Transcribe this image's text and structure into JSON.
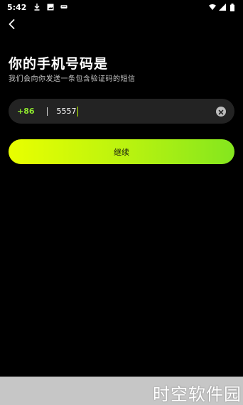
{
  "status_bar": {
    "time": "5:42",
    "icons_left": [
      "download-icon",
      "image-icon",
      "message-icon"
    ],
    "icons_right": [
      "wifi-icon",
      "signal-icon",
      "battery-icon"
    ]
  },
  "nav": {
    "back_icon": "chevron-left-icon"
  },
  "header": {
    "title": "你的手机号码是",
    "subtitle": "我们会向你发送一条包含验证码的短信"
  },
  "phone_input": {
    "country_code": "+86",
    "value": "5557",
    "clear_icon": "clear-icon"
  },
  "continue_button": {
    "label": "继续"
  },
  "watermark": {
    "text": "时空软件园"
  },
  "colors": {
    "accent_green": "#8ee62e",
    "button_gradient_start": "#e9ff00",
    "button_gradient_end": "#84e61e",
    "input_background": "#232323"
  }
}
